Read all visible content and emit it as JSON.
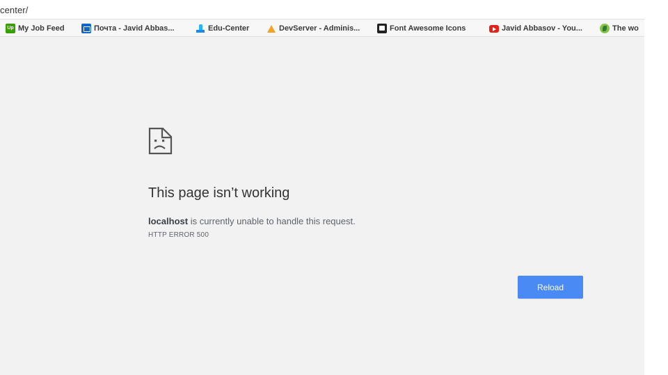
{
  "address_bar": {
    "url_text": "center/"
  },
  "bookmarks": [
    {
      "label": "My Job Feed",
      "icon": "upwork-icon",
      "icon_text": "Up"
    },
    {
      "label": "Почта - Javid Abbas...",
      "icon": "outlook-mail-icon"
    },
    {
      "label": "Edu-Center",
      "icon": "azure-icon"
    },
    {
      "label": "DevServer - Adminis...",
      "icon": "devserver-icon"
    },
    {
      "label": "Font Awesome Icons",
      "icon": "font-awesome-flag-icon"
    },
    {
      "label": "Javid Abbasov - You...",
      "icon": "youtube-icon"
    },
    {
      "label": "The wo",
      "icon": "site-leaf-icon"
    }
  ],
  "error_page": {
    "icon": "sad-page-icon",
    "title": "This page isn’t working",
    "host": "localhost",
    "message": " is currently unable to handle this request.",
    "error_code": "HTTP ERROR 500",
    "reload_label": "Reload"
  },
  "colors": {
    "page_background": "#f2f2f2",
    "reload_button": "#4a8af4",
    "title_text": "#333333"
  }
}
